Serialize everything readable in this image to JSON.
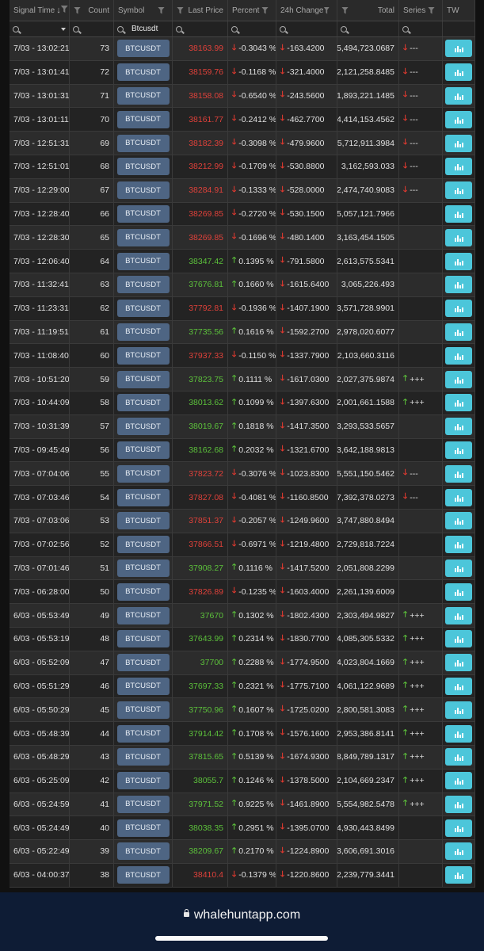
{
  "columns": {
    "signal_time": "Signal Time",
    "count": "Count",
    "symbol": "Symbol",
    "last_price": "Last Price",
    "percent": "Percent",
    "change_24h": "24h Change",
    "total": "Total",
    "series": "Series",
    "tw": "TW"
  },
  "filters": {
    "symbol_value": "Btcusdt"
  },
  "colors": {
    "up": "#5cc13b",
    "down": "#e0413a",
    "symbol_button": "#4e6583",
    "tw_button": "#4cc6da"
  },
  "rows": [
    {
      "time": "7/03 - 13:02:21",
      "count": "73",
      "symbol": "BTCUSDT",
      "price": "38163.99",
      "price_dir": "down",
      "pct": "-0.3043 %",
      "pct_dir": "down",
      "chg": "-163.4200",
      "total": "5,494,723.0687",
      "series": "---",
      "series_dir": "down"
    },
    {
      "time": "7/03 - 13:01:41",
      "count": "72",
      "symbol": "BTCUSDT",
      "price": "38159.76",
      "price_dir": "down",
      "pct": "-0.1168 %",
      "pct_dir": "down",
      "chg": "-321.4000",
      "total": "2,121,258.8485",
      "series": "---",
      "series_dir": "down"
    },
    {
      "time": "7/03 - 13:01:31",
      "count": "71",
      "symbol": "BTCUSDT",
      "price": "38158.08",
      "price_dir": "down",
      "pct": "-0.6540 %",
      "pct_dir": "down",
      "chg": "-243.5600",
      "total": "11,893,221.1485",
      "series": "---",
      "series_dir": "down"
    },
    {
      "time": "7/03 - 13:01:11",
      "count": "70",
      "symbol": "BTCUSDT",
      "price": "38161.77",
      "price_dir": "down",
      "pct": "-0.2412 %",
      "pct_dir": "down",
      "chg": "-462.7700",
      "total": "4,414,153.4562",
      "series": "---",
      "series_dir": "down"
    },
    {
      "time": "7/03 - 12:51:31",
      "count": "69",
      "symbol": "BTCUSDT",
      "price": "38182.39",
      "price_dir": "down",
      "pct": "-0.3098 %",
      "pct_dir": "down",
      "chg": "-479.9600",
      "total": "5,712,911.3984",
      "series": "---",
      "series_dir": "down"
    },
    {
      "time": "7/03 - 12:51:01",
      "count": "68",
      "symbol": "BTCUSDT",
      "price": "38212.99",
      "price_dir": "down",
      "pct": "-0.1709 %",
      "pct_dir": "down",
      "chg": "-530.8800",
      "total": "3,162,593.033",
      "series": "---",
      "series_dir": "down"
    },
    {
      "time": "7/03 - 12:29:00",
      "count": "67",
      "symbol": "BTCUSDT",
      "price": "38284.91",
      "price_dir": "down",
      "pct": "-0.1333 %",
      "pct_dir": "down",
      "chg": "-528.0000",
      "total": "2,474,740.9083",
      "series": "---",
      "series_dir": "down"
    },
    {
      "time": "7/03 - 12:28:40",
      "count": "66",
      "symbol": "BTCUSDT",
      "price": "38269.85",
      "price_dir": "down",
      "pct": "-0.2720 %",
      "pct_dir": "down",
      "chg": "-530.1500",
      "total": "5,057,121.7966",
      "series": "",
      "series_dir": ""
    },
    {
      "time": "7/03 - 12:28:30",
      "count": "65",
      "symbol": "BTCUSDT",
      "price": "38269.85",
      "price_dir": "down",
      "pct": "-0.1696 %",
      "pct_dir": "down",
      "chg": "-480.1400",
      "total": "3,163,454.1505",
      "series": "",
      "series_dir": ""
    },
    {
      "time": "7/03 - 12:06:40",
      "count": "64",
      "symbol": "BTCUSDT",
      "price": "38347.42",
      "price_dir": "up",
      "pct": "0.1395 %",
      "pct_dir": "up",
      "chg": "-791.5800",
      "total": "2,613,575.5341",
      "series": "",
      "series_dir": ""
    },
    {
      "time": "7/03 - 11:32:41",
      "count": "63",
      "symbol": "BTCUSDT",
      "price": "37676.81",
      "price_dir": "up",
      "pct": "0.1660 %",
      "pct_dir": "up",
      "chg": "-1615.6400",
      "total": "3,065,226.493",
      "series": "",
      "series_dir": ""
    },
    {
      "time": "7/03 - 11:23:31",
      "count": "62",
      "symbol": "BTCUSDT",
      "price": "37792.81",
      "price_dir": "down",
      "pct": "-0.1936 %",
      "pct_dir": "down",
      "chg": "-1407.1900",
      "total": "3,571,728.9901",
      "series": "",
      "series_dir": ""
    },
    {
      "time": "7/03 - 11:19:51",
      "count": "61",
      "symbol": "BTCUSDT",
      "price": "37735.56",
      "price_dir": "up",
      "pct": "0.1616 %",
      "pct_dir": "up",
      "chg": "-1592.2700",
      "total": "2,978,020.6077",
      "series": "",
      "series_dir": ""
    },
    {
      "time": "7/03 - 11:08:40",
      "count": "60",
      "symbol": "BTCUSDT",
      "price": "37937.33",
      "price_dir": "down",
      "pct": "-0.1150 %",
      "pct_dir": "down",
      "chg": "-1337.7900",
      "total": "2,103,660.3116",
      "series": "",
      "series_dir": ""
    },
    {
      "time": "7/03 - 10:51:20",
      "count": "59",
      "symbol": "BTCUSDT",
      "price": "37823.75",
      "price_dir": "up",
      "pct": "0.1111 %",
      "pct_dir": "up",
      "chg": "-1617.0300",
      "total": "2,027,375.9874",
      "series": "+++",
      "series_dir": "up"
    },
    {
      "time": "7/03 - 10:44:09",
      "count": "58",
      "symbol": "BTCUSDT",
      "price": "38013.62",
      "price_dir": "up",
      "pct": "0.1099 %",
      "pct_dir": "up",
      "chg": "-1397.6300",
      "total": "2,001,661.1588",
      "series": "+++",
      "series_dir": "up"
    },
    {
      "time": "7/03 - 10:31:39",
      "count": "57",
      "symbol": "BTCUSDT",
      "price": "38019.67",
      "price_dir": "up",
      "pct": "0.1818 %",
      "pct_dir": "up",
      "chg": "-1417.3500",
      "total": "3,293,533.5657",
      "series": "",
      "series_dir": ""
    },
    {
      "time": "7/03 - 09:45:49",
      "count": "56",
      "symbol": "BTCUSDT",
      "price": "38162.68",
      "price_dir": "up",
      "pct": "0.2032 %",
      "pct_dir": "up",
      "chg": "-1321.6700",
      "total": "3,642,188.9813",
      "series": "",
      "series_dir": ""
    },
    {
      "time": "7/03 - 07:04:06",
      "count": "55",
      "symbol": "BTCUSDT",
      "price": "37823.72",
      "price_dir": "down",
      "pct": "-0.3076 %",
      "pct_dir": "down",
      "chg": "-1023.8300",
      "total": "5,551,150.5462",
      "series": "---",
      "series_dir": "down"
    },
    {
      "time": "7/03 - 07:03:46",
      "count": "54",
      "symbol": "BTCUSDT",
      "price": "37827.08",
      "price_dir": "down",
      "pct": "-0.4081 %",
      "pct_dir": "down",
      "chg": "-1160.8500",
      "total": "7,392,378.0273",
      "series": "---",
      "series_dir": "down"
    },
    {
      "time": "7/03 - 07:03:06",
      "count": "53",
      "symbol": "BTCUSDT",
      "price": "37851.37",
      "price_dir": "down",
      "pct": "-0.2057 %",
      "pct_dir": "down",
      "chg": "-1249.9600",
      "total": "3,747,880.8494",
      "series": "",
      "series_dir": ""
    },
    {
      "time": "7/03 - 07:02:56",
      "count": "52",
      "symbol": "BTCUSDT",
      "price": "37866.51",
      "price_dir": "down",
      "pct": "-0.6971 %",
      "pct_dir": "down",
      "chg": "-1219.4800",
      "total": "12,729,818.7224",
      "series": "",
      "series_dir": ""
    },
    {
      "time": "7/03 - 07:01:46",
      "count": "51",
      "symbol": "BTCUSDT",
      "price": "37908.27",
      "price_dir": "up",
      "pct": "0.1116 %",
      "pct_dir": "up",
      "chg": "-1417.5200",
      "total": "2,051,808.2299",
      "series": "",
      "series_dir": ""
    },
    {
      "time": "7/03 - 06:28:00",
      "count": "50",
      "symbol": "BTCUSDT",
      "price": "37826.89",
      "price_dir": "down",
      "pct": "-0.1235 %",
      "pct_dir": "down",
      "chg": "-1603.4000",
      "total": "2,261,139.6009",
      "series": "",
      "series_dir": ""
    },
    {
      "time": "6/03 - 05:53:49",
      "count": "49",
      "symbol": "BTCUSDT",
      "price": "37670",
      "price_dir": "up",
      "pct": "0.1302 %",
      "pct_dir": "up",
      "chg": "-1802.4300",
      "total": "2,303,494.9827",
      "series": "+++",
      "series_dir": "up"
    },
    {
      "time": "6/03 - 05:53:19",
      "count": "48",
      "symbol": "BTCUSDT",
      "price": "37643.99",
      "price_dir": "up",
      "pct": "0.2314 %",
      "pct_dir": "up",
      "chg": "-1830.7700",
      "total": "4,085,305.5332",
      "series": "+++",
      "series_dir": "up"
    },
    {
      "time": "6/03 - 05:52:09",
      "count": "47",
      "symbol": "BTCUSDT",
      "price": "37700",
      "price_dir": "up",
      "pct": "0.2288 %",
      "pct_dir": "up",
      "chg": "-1774.9500",
      "total": "4,023,804.1669",
      "series": "+++",
      "series_dir": "up"
    },
    {
      "time": "6/03 - 05:51:29",
      "count": "46",
      "symbol": "BTCUSDT",
      "price": "37697.33",
      "price_dir": "up",
      "pct": "0.2321 %",
      "pct_dir": "up",
      "chg": "-1775.7100",
      "total": "4,061,122.9689",
      "series": "+++",
      "series_dir": "up"
    },
    {
      "time": "6/03 - 05:50:29",
      "count": "45",
      "symbol": "BTCUSDT",
      "price": "37750.96",
      "price_dir": "up",
      "pct": "0.1607 %",
      "pct_dir": "up",
      "chg": "-1725.0200",
      "total": "2,800,581.3083",
      "series": "+++",
      "series_dir": "up"
    },
    {
      "time": "6/03 - 05:48:39",
      "count": "44",
      "symbol": "BTCUSDT",
      "price": "37914.42",
      "price_dir": "up",
      "pct": "0.1708 %",
      "pct_dir": "up",
      "chg": "-1576.1600",
      "total": "2,953,386.8141",
      "series": "+++",
      "series_dir": "up"
    },
    {
      "time": "6/03 - 05:48:29",
      "count": "43",
      "symbol": "BTCUSDT",
      "price": "37815.65",
      "price_dir": "up",
      "pct": "0.5139 %",
      "pct_dir": "up",
      "chg": "-1674.9300",
      "total": "8,849,789.1317",
      "series": "+++",
      "series_dir": "up"
    },
    {
      "time": "6/03 - 05:25:09",
      "count": "42",
      "symbol": "BTCUSDT",
      "price": "38055.7",
      "price_dir": "up",
      "pct": "0.1246 %",
      "pct_dir": "up",
      "chg": "-1378.5000",
      "total": "2,104,669.2347",
      "series": "+++",
      "series_dir": "up"
    },
    {
      "time": "6/03 - 05:24:59",
      "count": "41",
      "symbol": "BTCUSDT",
      "price": "37971.52",
      "price_dir": "up",
      "pct": "0.9225 %",
      "pct_dir": "up",
      "chg": "-1461.8900",
      "total": "15,554,982.5478",
      "series": "+++",
      "series_dir": "up"
    },
    {
      "time": "6/03 - 05:24:49",
      "count": "40",
      "symbol": "BTCUSDT",
      "price": "38038.35",
      "price_dir": "up",
      "pct": "0.2951 %",
      "pct_dir": "up",
      "chg": "-1395.0700",
      "total": "4,930,443.8499",
      "series": "",
      "series_dir": ""
    },
    {
      "time": "6/03 - 05:22:49",
      "count": "39",
      "symbol": "BTCUSDT",
      "price": "38209.67",
      "price_dir": "up",
      "pct": "0.2170 %",
      "pct_dir": "up",
      "chg": "-1224.8900",
      "total": "3,606,691.3016",
      "series": "",
      "series_dir": ""
    },
    {
      "time": "6/03 - 04:00:37",
      "count": "38",
      "symbol": "BTCUSDT",
      "price": "38410.4",
      "price_dir": "down",
      "pct": "-0.1379 %",
      "pct_dir": "down",
      "chg": "-1220.8600",
      "total": "2,239,779.3441",
      "series": "",
      "series_dir": ""
    }
  ],
  "browser": {
    "url": "whalehuntapp.com"
  }
}
